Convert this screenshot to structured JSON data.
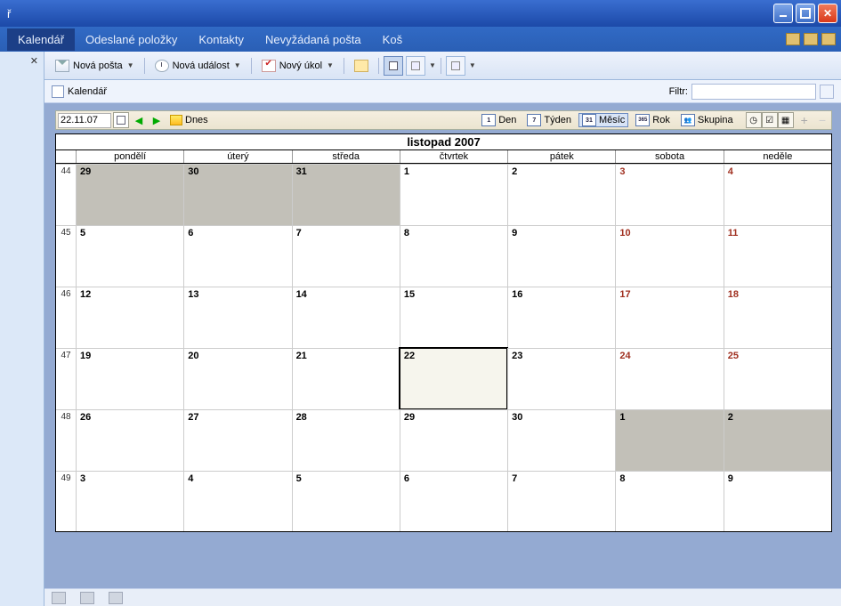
{
  "window": {
    "title_suffix": "ř"
  },
  "tabs": {
    "calendar": "Kalendář",
    "sent": "Odeslané položky",
    "contacts": "Kontakty",
    "spam": "Nevyžádaná pošta",
    "trash": "Koš"
  },
  "toolbar": {
    "new_mail": "Nová pošta",
    "new_event": "Nová událost",
    "new_task": "Nový úkol"
  },
  "header": {
    "calendar_label": "Kalendář",
    "filter_label": "Filtr:"
  },
  "calbar": {
    "date": "22.11.07",
    "today": "Dnes",
    "views": {
      "day": {
        "icon": "1",
        "label": "Den"
      },
      "week": {
        "icon": "7",
        "label": "Týden"
      },
      "month": {
        "icon": "31",
        "label": "Měsíc"
      },
      "year": {
        "icon": "365",
        "label": "Rok"
      },
      "group": {
        "label": "Skupina"
      }
    }
  },
  "month": {
    "title": "listopad 2007",
    "weekdays": [
      "pondělí",
      "úterý",
      "středa",
      "čtvrtek",
      "pátek",
      "sobota",
      "neděle"
    ],
    "weeks": [
      {
        "wn": "44",
        "days": [
          {
            "n": "29",
            "other": true
          },
          {
            "n": "30",
            "other": true
          },
          {
            "n": "31",
            "other": true
          },
          {
            "n": "1"
          },
          {
            "n": "2"
          },
          {
            "n": "3",
            "we": true
          },
          {
            "n": "4",
            "we": true
          }
        ]
      },
      {
        "wn": "45",
        "days": [
          {
            "n": "5"
          },
          {
            "n": "6"
          },
          {
            "n": "7"
          },
          {
            "n": "8"
          },
          {
            "n": "9"
          },
          {
            "n": "10",
            "we": true
          },
          {
            "n": "11",
            "we": true
          }
        ]
      },
      {
        "wn": "46",
        "days": [
          {
            "n": "12"
          },
          {
            "n": "13"
          },
          {
            "n": "14"
          },
          {
            "n": "15"
          },
          {
            "n": "16"
          },
          {
            "n": "17",
            "we": true
          },
          {
            "n": "18",
            "we": true
          }
        ]
      },
      {
        "wn": "47",
        "days": [
          {
            "n": "19"
          },
          {
            "n": "20"
          },
          {
            "n": "21"
          },
          {
            "n": "22",
            "today": true
          },
          {
            "n": "23"
          },
          {
            "n": "24",
            "we": true
          },
          {
            "n": "25",
            "we": true
          }
        ]
      },
      {
        "wn": "48",
        "days": [
          {
            "n": "26"
          },
          {
            "n": "27"
          },
          {
            "n": "28"
          },
          {
            "n": "29"
          },
          {
            "n": "30"
          },
          {
            "n": "1",
            "other": true
          },
          {
            "n": "2",
            "other": true
          }
        ]
      },
      {
        "wn": "49",
        "days": [
          {
            "n": "3"
          },
          {
            "n": "4"
          },
          {
            "n": "5"
          },
          {
            "n": "6"
          },
          {
            "n": "7"
          },
          {
            "n": "8"
          },
          {
            "n": "9"
          }
        ]
      }
    ]
  }
}
